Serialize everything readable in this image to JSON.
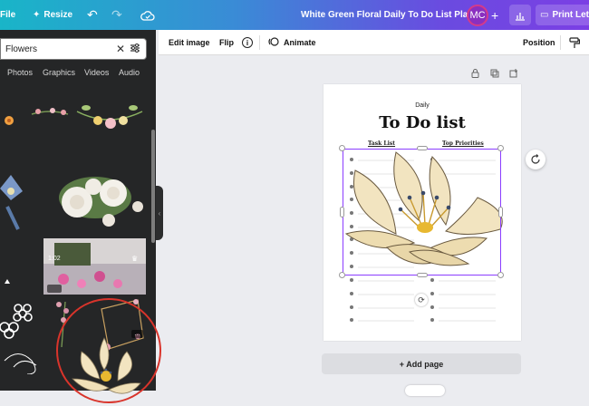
{
  "topbar": {
    "file_label": "File",
    "resize_label": "Resize",
    "doc_title": "White Green Floral Daily To Do List Planner",
    "avatar_initials": "MC",
    "add_label": "+",
    "print_label": "Print Lett",
    "undo_icon": "undo-icon",
    "redo_icon": "redo-icon",
    "cloud_icon": "cloud-save-icon",
    "chart_icon": "analytics-icon"
  },
  "sidebar": {
    "search_value": "Flowers",
    "tabs": [
      "Photos",
      "Graphics",
      "Videos",
      "Audio"
    ],
    "video_duration": "1:02",
    "more_label": "…"
  },
  "toolbar": {
    "edit_image": "Edit image",
    "flip": "Flip",
    "info": "i",
    "animate": "Animate",
    "position": "Position"
  },
  "planner": {
    "daily": "Daily",
    "title": "To Do list",
    "col1": "Task List",
    "col2": "Top Priorities"
  },
  "canvas": {
    "add_page": "+ Add page"
  },
  "colors": {
    "accent": "#7d2ae8",
    "selection": "#8b3dff",
    "selected_ring": "#d9342b"
  }
}
